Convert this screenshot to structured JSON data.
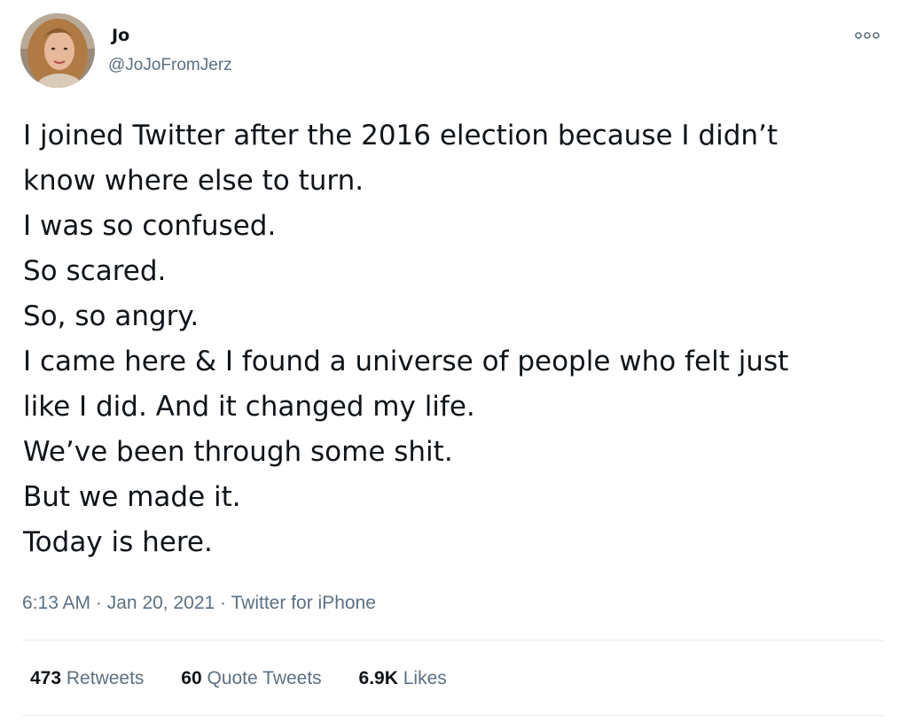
{
  "user": {
    "display_name": "Jo",
    "handle": "@JoJoFromJerz",
    "avatar_icon": "profile-photo"
  },
  "more_icon": "more-options-dots",
  "tweet_lines": [
    "I joined Twitter after the 2016 election because I didn’t",
    "know where else to turn.",
    "I was so confused.",
    "So scared.",
    "So, so angry.",
    "I came here & I found a universe of people who felt just",
    "like I did. And it changed my life.",
    "We’ve been through some shit.",
    "But we made it.",
    "Today is here."
  ],
  "meta": {
    "time": "6:13 AM",
    "separator": "·",
    "date": "Jan 20, 2021",
    "source": "Twitter for iPhone"
  },
  "stats": {
    "retweets_count": "473",
    "retweets_label": "Retweets",
    "quotes_count": "60",
    "quotes_label": "Quote Tweets",
    "likes_count": "6.9K",
    "likes_label": "Likes"
  },
  "colors": {
    "text": "#0f1419",
    "secondary": "#5b7083",
    "divider": "#e6ecf0"
  }
}
